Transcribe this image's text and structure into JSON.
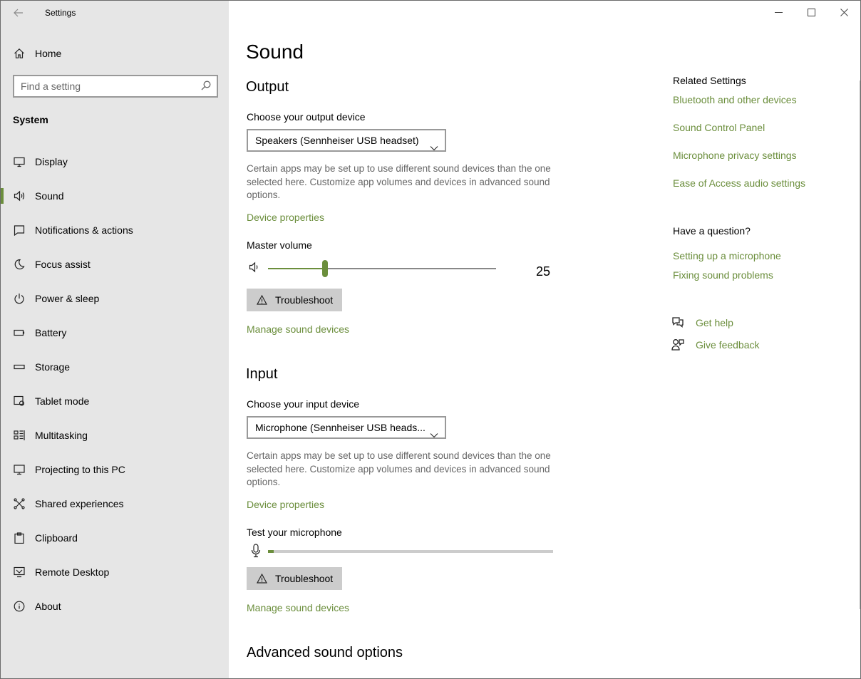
{
  "window": {
    "title": "Settings",
    "back_icon": "back-arrow-icon",
    "controls": [
      "minimize-icon",
      "maximize-icon",
      "close-icon"
    ]
  },
  "sidebar": {
    "home": {
      "label": "Home",
      "icon": "home-icon"
    },
    "search": {
      "placeholder": "Find a setting",
      "icon": "search-icon"
    },
    "group_label": "System",
    "selected": "Sound",
    "items": [
      {
        "label": "Display",
        "icon": "display-icon"
      },
      {
        "label": "Sound",
        "icon": "speaker-icon"
      },
      {
        "label": "Notifications & actions",
        "icon": "notification-icon"
      },
      {
        "label": "Focus assist",
        "icon": "moon-icon"
      },
      {
        "label": "Power & sleep",
        "icon": "power-icon"
      },
      {
        "label": "Battery",
        "icon": "battery-icon"
      },
      {
        "label": "Storage",
        "icon": "storage-icon"
      },
      {
        "label": "Tablet mode",
        "icon": "tablet-mode-icon"
      },
      {
        "label": "Multitasking",
        "icon": "multitasking-icon"
      },
      {
        "label": "Projecting to this PC",
        "icon": "projector-icon"
      },
      {
        "label": "Shared experiences",
        "icon": "shared-experiences-icon"
      },
      {
        "label": "Clipboard",
        "icon": "clipboard-icon"
      },
      {
        "label": "Remote Desktop",
        "icon": "remote-desktop-icon"
      },
      {
        "label": "About",
        "icon": "info-icon"
      }
    ]
  },
  "main": {
    "title": "Sound",
    "output": {
      "heading": "Output",
      "device_label": "Choose your output device",
      "device_value": "Speakers (Sennheiser USB headset)",
      "description": "Certain apps may be set up to use different sound devices than the one selected here. Customize app volumes and devices in advanced sound options.",
      "device_properties": "Device properties",
      "volume_label": "Master volume",
      "volume_value": "25",
      "volume_level": 0.25,
      "troubleshoot": "Troubleshoot",
      "manage": "Manage sound devices"
    },
    "input": {
      "heading": "Input",
      "device_label": "Choose your input device",
      "device_value": "Microphone (Sennheiser USB heads...",
      "description": "Certain apps may be set up to use different sound devices than the one selected here. Customize app volumes and devices in advanced sound options.",
      "device_properties": "Device properties",
      "test_label": "Test your microphone",
      "mic_level": 0.02,
      "troubleshoot": "Troubleshoot",
      "manage": "Manage sound devices"
    },
    "advanced_heading": "Advanced sound options"
  },
  "related": {
    "heading": "Related Settings",
    "links": [
      "Bluetooth and other devices",
      "Sound Control Panel",
      "Microphone privacy settings",
      "Ease of Access audio settings"
    ],
    "question_heading": "Have a question?",
    "question_links": [
      "Setting up a microphone",
      "Fixing sound problems"
    ],
    "get_help": "Get help",
    "give_feedback": "Give feedback"
  },
  "colors": {
    "accent": "#6b8e3c",
    "sidebar_bg": "#e6e6e6"
  }
}
